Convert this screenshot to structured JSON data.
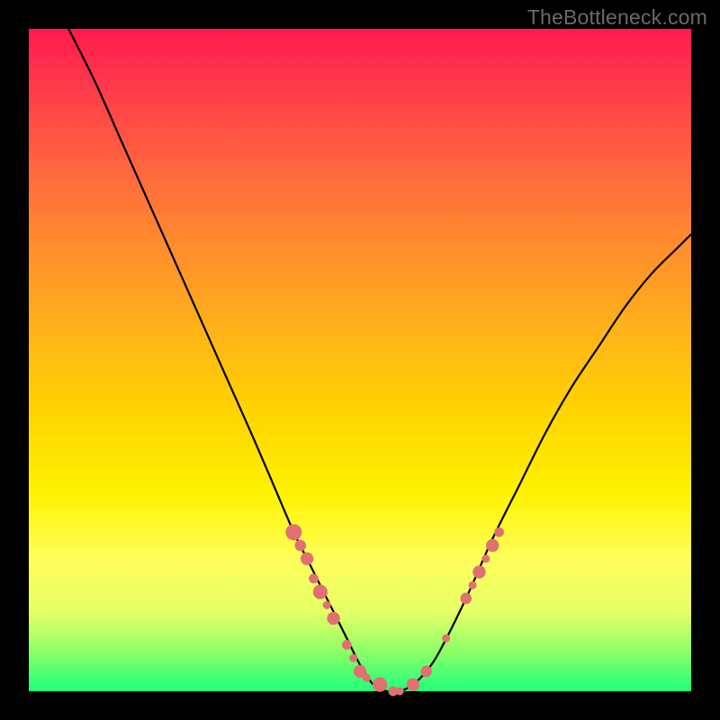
{
  "watermark": "TheBottleneck.com",
  "chart_data": {
    "type": "line",
    "title": "",
    "xlabel": "",
    "ylabel": "",
    "xlim": [
      0,
      100
    ],
    "ylim": [
      0,
      100
    ],
    "series": [
      {
        "name": "curve",
        "x": [
          6,
          10,
          14,
          18,
          22,
          26,
          30,
          34,
          37,
          40,
          42,
          44,
          46,
          48,
          50,
          52,
          54,
          56,
          58,
          60,
          62,
          66,
          70,
          74,
          78,
          82,
          86,
          90,
          94,
          98,
          100
        ],
        "y": [
          100,
          92,
          83,
          74,
          65,
          56,
          47,
          38,
          31,
          24,
          20,
          16,
          12,
          8,
          4,
          1,
          0,
          0,
          1,
          3,
          6,
          14,
          23,
          31,
          39,
          46,
          52,
          58,
          63,
          67,
          69
        ]
      }
    ],
    "markers": [
      {
        "x": 40,
        "y": 24,
        "size": 2.0
      },
      {
        "x": 41,
        "y": 22,
        "size": 1.4
      },
      {
        "x": 42,
        "y": 20,
        "size": 1.6
      },
      {
        "x": 43,
        "y": 17,
        "size": 1.2
      },
      {
        "x": 44,
        "y": 15,
        "size": 1.8
      },
      {
        "x": 45,
        "y": 13,
        "size": 1.0
      },
      {
        "x": 46,
        "y": 11,
        "size": 1.6
      },
      {
        "x": 48,
        "y": 7,
        "size": 1.2
      },
      {
        "x": 49,
        "y": 5,
        "size": 1.0
      },
      {
        "x": 50,
        "y": 3,
        "size": 1.6
      },
      {
        "x": 51,
        "y": 2,
        "size": 1.0
      },
      {
        "x": 53,
        "y": 1,
        "size": 1.8
      },
      {
        "x": 55,
        "y": 0,
        "size": 1.2
      },
      {
        "x": 56,
        "y": 0,
        "size": 1.0
      },
      {
        "x": 58,
        "y": 1,
        "size": 1.6
      },
      {
        "x": 60,
        "y": 3,
        "size": 1.4
      },
      {
        "x": 63,
        "y": 8,
        "size": 1.0
      },
      {
        "x": 66,
        "y": 14,
        "size": 1.4
      },
      {
        "x": 67,
        "y": 16,
        "size": 1.0
      },
      {
        "x": 68,
        "y": 18,
        "size": 1.6
      },
      {
        "x": 69,
        "y": 20,
        "size": 1.0
      },
      {
        "x": 70,
        "y": 22,
        "size": 1.6
      },
      {
        "x": 71,
        "y": 24,
        "size": 1.2
      }
    ],
    "marker_color": "#e27070",
    "curve_color": "#000000"
  }
}
